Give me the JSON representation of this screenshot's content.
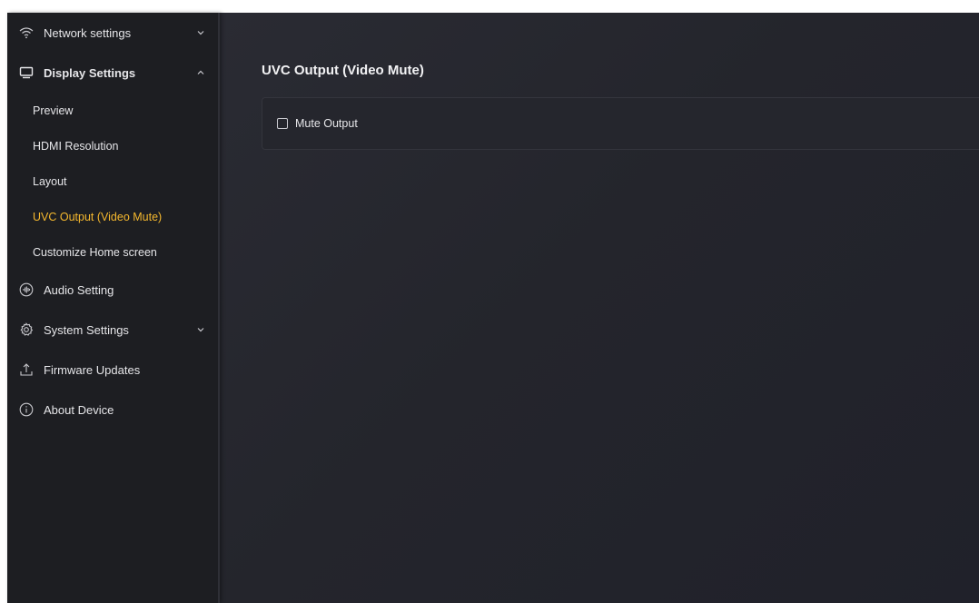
{
  "sidebar": {
    "network": {
      "label": "Network settings",
      "icon": "wifi-icon"
    },
    "display": {
      "label": "Display Settings",
      "icon": "monitor-icon",
      "subitems": [
        {
          "label": "Preview"
        },
        {
          "label": "HDMI Resolution"
        },
        {
          "label": "Layout"
        },
        {
          "label": "UVC Output (Video Mute)"
        },
        {
          "label": "Customize Home screen"
        }
      ]
    },
    "audio": {
      "label": "Audio Setting",
      "icon": "audio-wave-icon"
    },
    "system": {
      "label": "System Settings",
      "icon": "gear-icon"
    },
    "firmware": {
      "label": "Firmware Updates",
      "icon": "upload-icon"
    },
    "about": {
      "label": "About Device",
      "icon": "info-icon"
    }
  },
  "main": {
    "title": "UVC Output (Video Mute)",
    "mute_output": {
      "label": "Mute Output",
      "checked": false
    }
  },
  "colors": {
    "active": "#f5b82e",
    "sidebar_bg": "#1d1e22",
    "main_bg": "#24252c",
    "text": "#e6e6e9"
  }
}
